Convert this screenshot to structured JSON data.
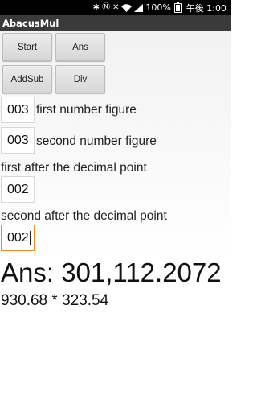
{
  "status_bar": {
    "battery": "100%",
    "time": "午後 1:00"
  },
  "app": {
    "title": "AbacusMul"
  },
  "buttons": {
    "start": "Start",
    "ans": "Ans",
    "addsub": "AddSub",
    "div": "Div"
  },
  "inputs": {
    "first_number_figure": {
      "value": "003",
      "label": "first number figure"
    },
    "second_number_figure": {
      "value": "003",
      "label": "second number figure"
    },
    "first_after_decimal": {
      "value": "002",
      "label": "first after the decimal point"
    },
    "second_after_decimal": {
      "value": "002",
      "label": "second after the decimal point"
    }
  },
  "result": {
    "answer": "Ans: 301,112.2072",
    "expression": "930.68 * 323.54"
  }
}
